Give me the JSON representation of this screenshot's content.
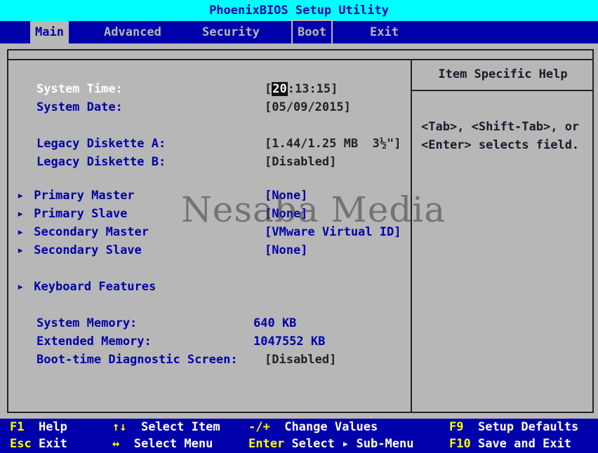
{
  "title": "PhoenixBIOS Setup Utility",
  "menu": [
    "Main",
    "Advanced",
    "Security",
    "Boot",
    "Exit"
  ],
  "fields": {
    "system_time": {
      "label": "System Time:",
      "hour": "20",
      "rest": ":13:15]",
      "open": "["
    },
    "system_date": {
      "label": "System Date:",
      "value": "[05/09/2015]"
    },
    "legacy_a": {
      "label": "Legacy Diskette A:",
      "value": "[1.44/1.25 MB  3½\"]"
    },
    "legacy_b": {
      "label": "Legacy Diskette B:",
      "value": "[Disabled]"
    },
    "primary_master": {
      "label": "Primary Master",
      "value": "[None]"
    },
    "primary_slave": {
      "label": "Primary Slave",
      "value": "[None]"
    },
    "secondary_master": {
      "label": "Secondary Master",
      "value": "[VMware Virtual ID]"
    },
    "secondary_slave": {
      "label": "Secondary Slave",
      "value": "[None]"
    },
    "keyboard": {
      "label": "Keyboard Features"
    },
    "system_memory": {
      "label": "System Memory:",
      "value": "640 KB"
    },
    "extended_memory": {
      "label": "Extended Memory:",
      "value": "1047552 KB"
    },
    "diag_screen": {
      "label": "Boot-time Diagnostic Screen:",
      "value": "[Disabled]"
    }
  },
  "help": {
    "title": "Item Specific Help",
    "line1": "<Tab>, <Shift-Tab>, or",
    "line2": "<Enter> selects field."
  },
  "watermark": "Nesaba Media",
  "footer": {
    "f1_key": "F1",
    "f1_txt": "Help",
    "updown_key": "↑↓",
    "updown_txt": "Select Item",
    "minus_key": "-/+",
    "minus_txt": "Change Values",
    "f9_key": "F9",
    "f9_txt": "Setup Defaults",
    "esc_key": "Esc",
    "esc_txt": "Exit",
    "lr_key": "↔",
    "lr_txt": "Select Menu",
    "enter_key": "Enter",
    "enter_txt": "Select ▸ Sub-Menu",
    "f10_key": "F10",
    "f10_txt": "Save and Exit"
  },
  "colors": {
    "bg": "#b7b7b7",
    "menubar": "#0000aa",
    "titlebar": "#00ffff",
    "footer_key": "#ffff00",
    "footer_text": "#ffffff"
  },
  "icons": {
    "submenu": "triangle-right-icon"
  }
}
